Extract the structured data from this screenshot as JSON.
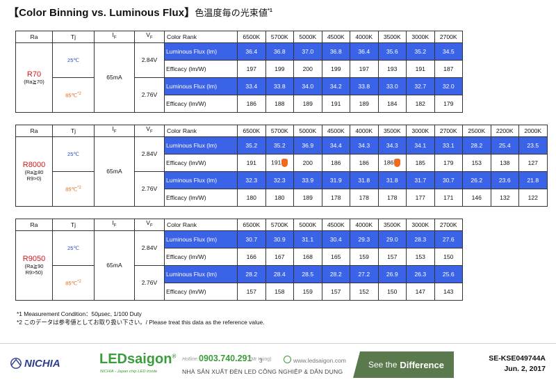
{
  "title": {
    "main": "【Color Binning vs. Luminous Flux】",
    "sub": "色温度毎の光束値",
    "sup": "*1"
  },
  "header_labels": {
    "ra": "Ra",
    "tj": "Tj",
    "if_main": "I",
    "if_sub": "F",
    "vf_main": "V",
    "vf_sub": "F",
    "color_rank": "Color Rank"
  },
  "row_labels": {
    "flux": "Luminous Flux (lm)",
    "efficacy": "Efficacy (lm/W)"
  },
  "temps": {
    "t25": "25℃",
    "t85": "85℃",
    "t85_sup": "*2"
  },
  "current": "65mA",
  "tables": [
    {
      "ra_code": "R70",
      "ra_note": "(Ra≧70)",
      "vf_25": "2.84V",
      "vf_85": "2.76V",
      "ranks": [
        "6500K",
        "5700K",
        "5000K",
        "4500K",
        "4000K",
        "3500K",
        "3000K",
        "2700K"
      ],
      "flux_25": [
        "36.4",
        "36.8",
        "37.0",
        "36.8",
        "36.4",
        "35.6",
        "35.2",
        "34.5"
      ],
      "eff_25": [
        "197",
        "199",
        "200",
        "199",
        "197",
        "193",
        "191",
        "187"
      ],
      "flux_85": [
        "33.4",
        "33.8",
        "34.0",
        "34.2",
        "33.8",
        "33.0",
        "32.7",
        "32.0"
      ],
      "eff_85": [
        "186",
        "188",
        "189",
        "191",
        "189",
        "184",
        "182",
        "179"
      ]
    },
    {
      "ra_code": "R8000",
      "ra_note": "(Ra≧80",
      "ra_note2": "R9>0)",
      "vf_25": "2.84V",
      "vf_85": "2.76V",
      "ranks": [
        "6500K",
        "5700K",
        "5000K",
        "4500K",
        "4000K",
        "3500K",
        "3000K",
        "2700K",
        "2500K",
        "2200K",
        "2000K"
      ],
      "flux_25": [
        "35.2",
        "35.2",
        "36.9",
        "34.4",
        "34.3",
        "34.3",
        "34.1",
        "33.1",
        "28.2",
        "25.4",
        "23.5"
      ],
      "eff_25": [
        "191",
        "191",
        "200",
        "186",
        "186",
        "186",
        "185",
        "179",
        "153",
        "138",
        "127"
      ],
      "flux_85": [
        "32.3",
        "32.3",
        "33.9",
        "31.9",
        "31.8",
        "31.8",
        "31.7",
        "30.7",
        "26.2",
        "23.6",
        "21.8"
      ],
      "eff_85": [
        "180",
        "180",
        "189",
        "178",
        "178",
        "178",
        "177",
        "171",
        "146",
        "132",
        "122"
      ]
    },
    {
      "ra_code": "R9050",
      "ra_note": "(Ra≧90",
      "ra_note2": "R9>50)",
      "vf_25": "2.84V",
      "vf_85": "2.76V",
      "ranks": [
        "6500K",
        "5700K",
        "5000K",
        "4500K",
        "4000K",
        "3500K",
        "3000K",
        "2700K"
      ],
      "flux_25": [
        "30.7",
        "30.9",
        "31.1",
        "30.4",
        "29.3",
        "29.0",
        "28.3",
        "27.6"
      ],
      "eff_25": [
        "166",
        "167",
        "168",
        "165",
        "159",
        "157",
        "153",
        "150"
      ],
      "flux_85": [
        "28.2",
        "28.4",
        "28.5",
        "28.2",
        "27.2",
        "26.9",
        "26.3",
        "25.6"
      ],
      "eff_85": [
        "157",
        "158",
        "159",
        "157",
        "152",
        "150",
        "147",
        "143"
      ]
    }
  ],
  "notes": {
    "note1": "*1 Measurement Condition：50μsec, 1/100 Duty",
    "note2": "*2 このデータは参考値としてお取り扱い下さい。/ Please treat this data as the reference value."
  },
  "footer": {
    "nichia": "NICHIA",
    "leds_brand": "LEDsaigon",
    "leds_reg": "®",
    "leds_tagline": "NICHIA - Japan chip LED inside",
    "hotline_label": "Hotline:",
    "hotline_number": "0903.740.291",
    "hotline_name": "(Mr Hùng)",
    "page_number": "3",
    "website": "www.ledsaigon.com",
    "vietnamese_line": "NHÀ SẢN XUẤT ĐÈN LED CÔNG NGHIỆP & DÂN DỤNG",
    "slogan_see": "See the",
    "slogan_diff": "Difference",
    "doc_code": "SE-KSE049744A",
    "doc_date": "Jun. 2, 2017"
  },
  "colors": {
    "flux_highlight": "#3b63e8",
    "marker": "#ee6b1f",
    "ra_code": "#d01818",
    "temp_25": "#2b46c8",
    "temp_85": "#e86a10",
    "brand_green": "#3a9c3a"
  }
}
